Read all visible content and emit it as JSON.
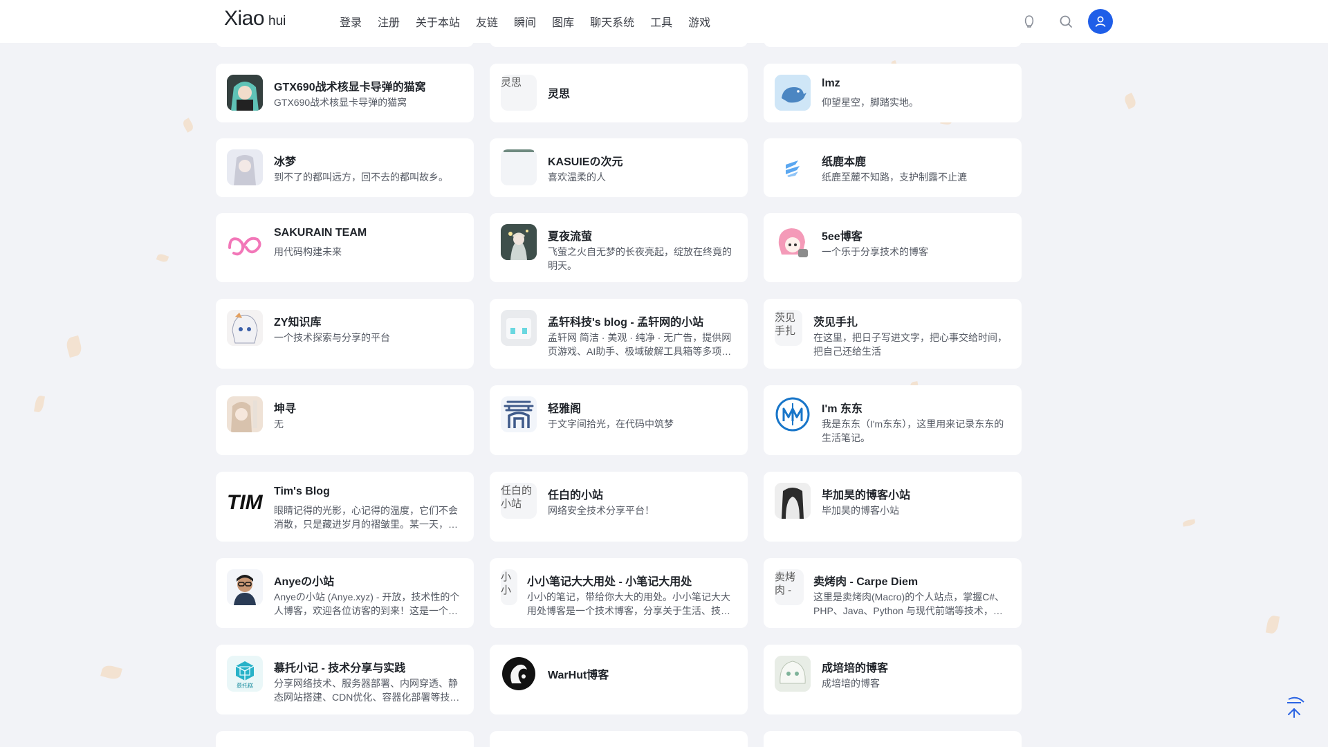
{
  "site": {
    "logo_main": "Xiao",
    "logo_sub": "hui"
  },
  "nav": [
    {
      "label": "登录"
    },
    {
      "label": "注册"
    },
    {
      "label": "关于本站"
    },
    {
      "label": "友链"
    },
    {
      "label": "瞬间"
    },
    {
      "label": "图库"
    },
    {
      "label": "聊天系统"
    },
    {
      "label": "工具"
    },
    {
      "label": "游戏"
    }
  ],
  "header_icons": [
    "theme-icon",
    "search-icon",
    "user-icon"
  ],
  "colors": {
    "accent": "#1f5ee8",
    "page_bg": "#f2f3f7",
    "card_bg": "#ffffff",
    "petal": "#f3dcc4"
  },
  "cards": {
    "col1": [
      {
        "title": "GTX690战术核显卡导弹的猫窝",
        "desc": "GTX690战术核显卡导弹的猫窝"
      },
      {
        "title": "冰梦",
        "desc": "到不了的都叫远方，回不去的都叫故乡。"
      },
      {
        "title": "SAKURAIN TEAM",
        "desc": "用代码构建未来"
      },
      {
        "title": "ZY知识库",
        "desc": "一个技术探索与分享的平台"
      },
      {
        "title": "坤寻",
        "desc": "无"
      },
      {
        "title": "Tim's Blog",
        "desc": "眼睛记得的光影，心记得的温度，它们不会消散，只是藏进岁月的褶皱里。某一天，…"
      },
      {
        "title": "Anyeの小站",
        "desc": "Anyeの小站 (Anye.xyz) - 开放，技术性的个人博客，欢迎各位访客的到来！这是一个…"
      },
      {
        "title": "慕托小记 - 技术分享与实践",
        "desc": "分享网络技术、服务器部署、内网穿透、静态网站搭建、CDN优化、容器化部署等技…",
        "thumb_text": "慕托糕"
      }
    ],
    "col2": [
      {
        "title": "灵思",
        "desc": "",
        "alt": "灵思"
      },
      {
        "title": "KASUIEの次元",
        "desc": "喜欢温柔的人"
      },
      {
        "title": "夏夜流萤",
        "desc": "飞萤之火自无梦的长夜亮起，绽放在终竟的明天。"
      },
      {
        "title": "孟轩科技's blog - 孟轩网的小站",
        "desc": "孟轩网 简洁 · 美观 · 纯净 · 无广告，提供网页游戏、AI助手、极域破解工具箱等多项…"
      },
      {
        "title": "轻雅阁",
        "desc": "于文字间拾光，在代码中筑梦"
      },
      {
        "title": "任白的小站",
        "desc": "网络安全技术分享平台！",
        "alt": "任白的小站"
      },
      {
        "title": "小小笔记大大用处 - 小笔记大用处",
        "desc": "小小的笔记，带给你大大的用处。小小笔记大大用处博客是一个技术博客，分享关于生活、技…",
        "alt": "小小"
      },
      {
        "title": "WarHut博客",
        "desc": ""
      }
    ],
    "col3": [
      {
        "title": "lmz",
        "desc": "仰望星空，脚踏实地。"
      },
      {
        "title": "纸鹿本鹿",
        "desc": "纸鹿至麓不知路，支护制露不止漉"
      },
      {
        "title": "5ee博客",
        "desc": "一个乐于分享技术的博客"
      },
      {
        "title": "茨见手扎",
        "desc": "在这里，把日子写进文字，把心事交给时间，把自己还给生活",
        "alt": "茨见手扎"
      },
      {
        "title": "I'm 东东",
        "desc": "我是东东（I'm东东），这里用来记录东东的生活笔记。"
      },
      {
        "title": "毕加昊的博客小站",
        "desc": "毕加昊的博客小站"
      },
      {
        "title": "卖烤肉 - Carpe Diem",
        "desc": "这里是卖烤肉(Macro)的个人站点，掌握C#、PHP、Java、Python 与现代前端等技术，…",
        "alt": "卖烤肉 -"
      },
      {
        "title": "成培培的博客",
        "desc": "成培培的博客"
      }
    ]
  }
}
